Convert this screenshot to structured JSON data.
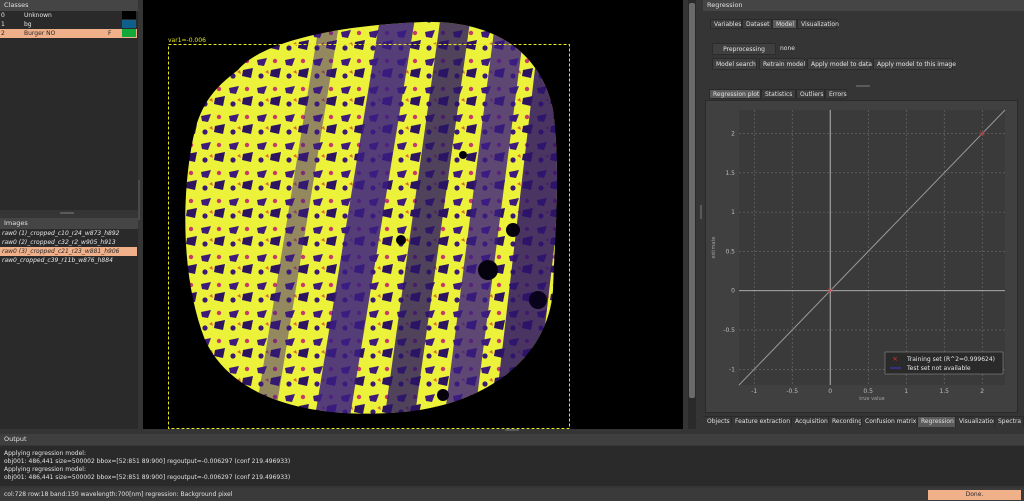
{
  "classes": {
    "title": "Classes",
    "rows": [
      {
        "index": "0",
        "name": "Unknown",
        "flag": "",
        "color": "#000000",
        "selected": false
      },
      {
        "index": "1",
        "name": "bg",
        "flag": "",
        "color": "#0f5f8c",
        "selected": false
      },
      {
        "index": "2",
        "name": "Burger NO",
        "flag": "F",
        "color": "#12a83a",
        "selected": true
      }
    ]
  },
  "images": {
    "title": "Images",
    "items": [
      {
        "label": "raw0 (1)_cropped_c10_r24_w873_h892",
        "selected": false
      },
      {
        "label": "raw0 (2)_cropped_c32_r2_w905_h913",
        "selected": false
      },
      {
        "label": "raw0 (3)_cropped_c21_r23_w881_h906",
        "selected": true
      },
      {
        "label": "raw0_cropped_c39_r11b_w876_h884",
        "selected": false
      }
    ]
  },
  "viewer": {
    "overlay_label": "var1=-0.006"
  },
  "regression": {
    "title": "Regression",
    "top_tabs": [
      "Variables",
      "Dataset",
      "Model",
      "Visualization"
    ],
    "active_top_tab": 2,
    "preprocessing_button": "Preprocessing",
    "preprocessing_value": "none",
    "actions": [
      "Model search",
      "Retrain model",
      "Apply model to data",
      "Apply model to this image"
    ],
    "plot_tabs": [
      "Regression plot",
      "Statistics",
      "Outliers",
      "Errors"
    ],
    "active_plot_tab": 0
  },
  "chart_data": {
    "type": "scatter",
    "xlabel": "true value",
    "ylabel": "estimate",
    "xlim": [
      -1.2,
      2.3
    ],
    "ylim": [
      -1.2,
      2.3
    ],
    "x_ticks": [
      "-1",
      "-0.5",
      "0",
      "0.5",
      "1",
      "1.5",
      "2"
    ],
    "x_tick_values": [
      -1,
      -0.5,
      0,
      0.5,
      1,
      1.5,
      2
    ],
    "y_ticks": [
      "2",
      "1.5",
      "1",
      "0.5",
      "0",
      "-0.5",
      "-1"
    ],
    "y_tick_values": [
      2,
      1.5,
      1,
      0.5,
      0,
      -0.5,
      -1
    ],
    "grid": true,
    "legend_position": "bottom-right",
    "legend": [
      "Training set (R^2=0.999624)",
      "Test set not available"
    ],
    "series": [
      {
        "name": "Training set (R^2=0.999624)",
        "points": [
          [
            0,
            0
          ],
          [
            2,
            2.0
          ]
        ],
        "color": "#e03030"
      }
    ],
    "fit_line": {
      "from": [
        -1.2,
        -1.2
      ],
      "to": [
        2.3,
        2.3
      ]
    }
  },
  "bottom_tabs": [
    "Objects",
    "Feature extraction",
    "Acquisition",
    "Recording",
    "Confusion matrix",
    "Regression",
    "Visualization",
    "Spectra"
  ],
  "active_bottom_tab": 5,
  "output": {
    "title": "Output",
    "lines": [
      "Applying regression model:",
      "obj001: 486,441 size=500002 bbox=[52:851 89:900] regoutput=-0.006297 (conf 219.496933)",
      "Applying regression model:",
      "obj001: 486,441 size=500002 bbox=[52:851 89:900] regoutput=-0.006297 (conf 219.496933)"
    ]
  },
  "status": {
    "text": "col:728 row:18 band:150 wavelength:700[nm] regression: Background pixel",
    "done": "Done."
  }
}
